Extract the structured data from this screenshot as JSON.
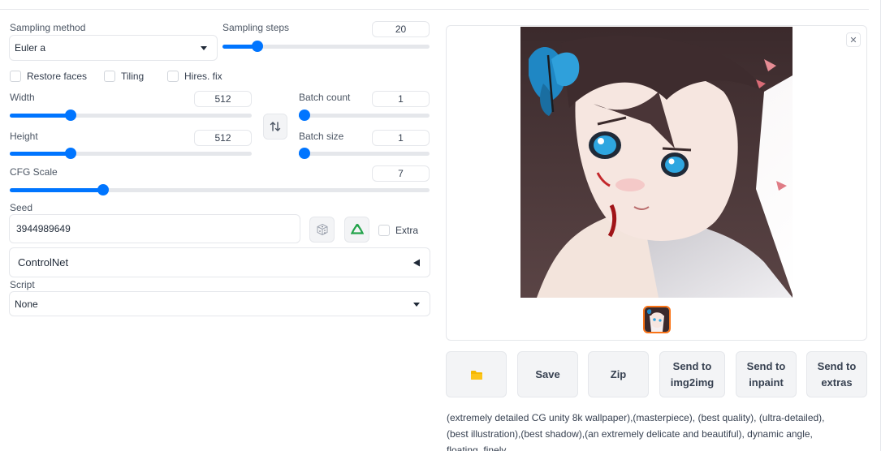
{
  "sampling": {
    "method_label": "Sampling method",
    "method_value": "Euler a",
    "steps_label": "Sampling steps",
    "steps_value": "20",
    "steps_fraction": 0.15
  },
  "options": {
    "restore_faces": "Restore faces",
    "tiling": "Tiling",
    "hires_fix": "Hires. fix"
  },
  "width": {
    "label": "Width",
    "value": "512",
    "fraction": 0.24
  },
  "height": {
    "label": "Height",
    "value": "512",
    "fraction": 0.24
  },
  "swap_icon": "swap-dimensions-icon",
  "batch_count": {
    "label": "Batch count",
    "value": "1",
    "fraction": 0.0
  },
  "batch_size": {
    "label": "Batch size",
    "value": "1",
    "fraction": 0.0
  },
  "cfg": {
    "label": "CFG Scale",
    "value": "7",
    "fraction": 0.215
  },
  "seed": {
    "label": "Seed",
    "value": "3944989649",
    "random_icon": "dice-icon",
    "reuse_icon": "recycle-icon",
    "extra_label": "Extra"
  },
  "controlnet": {
    "label": "ControlNet"
  },
  "script": {
    "label": "Script",
    "value": "None"
  },
  "gallery": {
    "close_icon": "close-icon"
  },
  "actions": {
    "folder_icon": "folder-icon",
    "save": "Save",
    "zip": "Zip",
    "send_img2img": "Send to\nimg2img",
    "send_inpaint": "Send to\ninpaint",
    "send_extras": "Send to\nextras"
  },
  "prompt_text": "(extremely detailed CG unity 8k wallpaper),(masterpiece), (best quality), (ultra-detailed), (best illustration),(best shadow),(an extremely delicate and beautiful), dynamic angle, floating, finely",
  "colors": {
    "accent": "#0075ff",
    "thumb_border": "#f97316",
    "folder": "#f5b800"
  }
}
